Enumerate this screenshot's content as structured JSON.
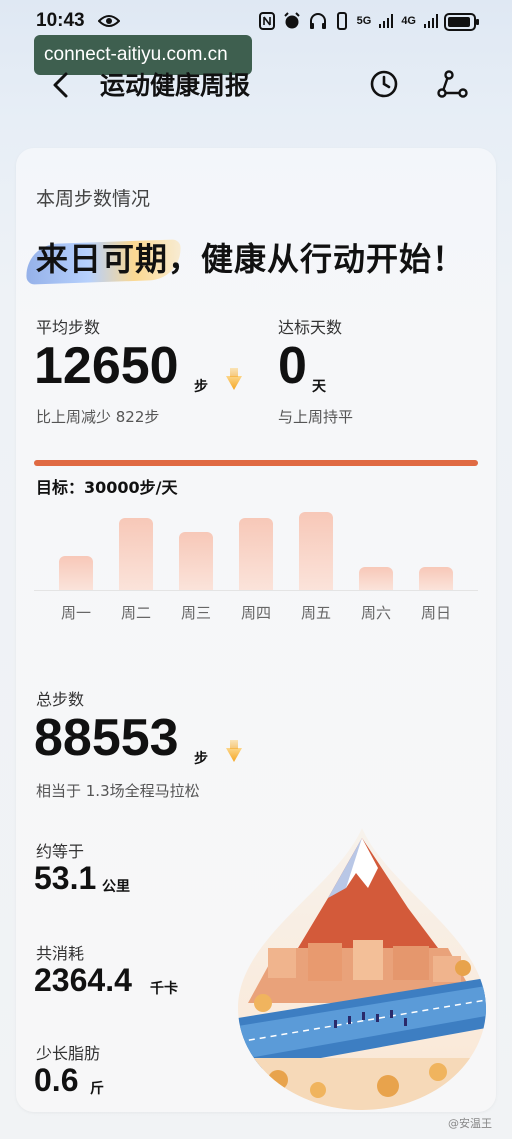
{
  "status": {
    "time": "10:43",
    "net1": "5G",
    "net2": "4G"
  },
  "overlay_url": "connect-aitiyu.com.cn",
  "header": {
    "title": "运动健康周报"
  },
  "card": {
    "section_title": "本周步数情况",
    "slogan": "来日可期，健康从行动开始！",
    "avg": {
      "label": "平均步数",
      "value": "12650",
      "unit": "步",
      "compare": "比上周减少 822步"
    },
    "target_days": {
      "label": "达标天数",
      "value": "0",
      "unit": "天",
      "compare": "与上周持平"
    },
    "goal_text": "目标：30000步/天",
    "days": [
      {
        "label": "周一",
        "level": 0.37
      },
      {
        "label": "周二",
        "level": 0.78
      },
      {
        "label": "周三",
        "level": 0.63
      },
      {
        "label": "周四",
        "level": 0.78
      },
      {
        "label": "周五",
        "level": 0.85
      },
      {
        "label": "周六",
        "level": 0.25
      },
      {
        "label": "周日",
        "level": 0.25
      }
    ],
    "total": {
      "label": "总步数",
      "value": "88553",
      "unit": "步",
      "compare": "相当于 1.3场全程马拉松"
    },
    "distance": {
      "label": "约等于",
      "value": "53.1",
      "unit": "公里"
    },
    "calories": {
      "label": "共消耗",
      "value": "2364.4",
      "unit": "千卡"
    },
    "fat": {
      "label": "少长脂肪",
      "value": "0.6",
      "unit": "斤"
    }
  },
  "watermark": "@安温王",
  "colors": {
    "accent": "#e06a43",
    "bar": "#f7c8b8",
    "arrow": "#f5a623"
  }
}
